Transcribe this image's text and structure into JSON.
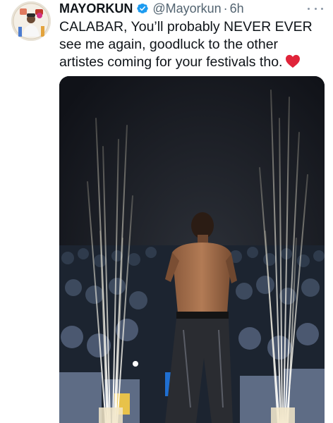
{
  "tweet": {
    "author_name": "MAYORKUN",
    "author_handle": "@Mayorkun",
    "separator": "·",
    "time": "6h",
    "text": "CALABAR, You’ll probably NEVER EVER  see me again, goodluck to the other artistes coming for your festivals tho.",
    "emoji": "red-heart"
  },
  "icons": {
    "verified": "verified-badge-icon",
    "more": "more-options-icon"
  },
  "colors": {
    "verified": "#1d9bf0",
    "heart": "#e0243a",
    "text": "#0f1419",
    "muted": "#536471"
  }
}
